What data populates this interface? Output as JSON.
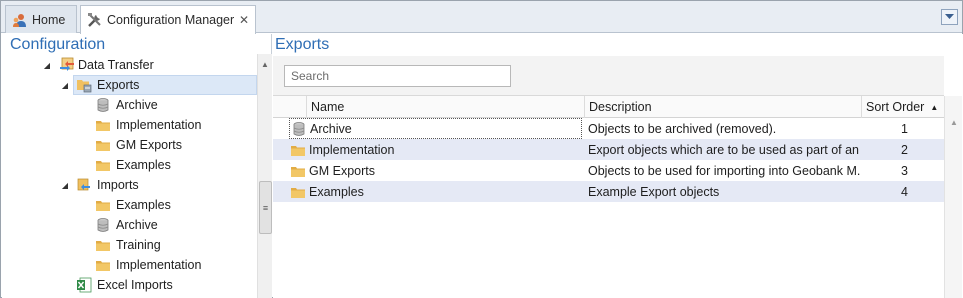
{
  "tabs": [
    {
      "label": "Home",
      "icon": "home-icon"
    },
    {
      "label": "Configuration Manager",
      "icon": "tools-icon"
    }
  ],
  "left_pane": {
    "title": "Configuration",
    "tree": [
      {
        "label": "Data Transfer",
        "icon": "data-transfer-icon",
        "expanded": true,
        "selected": false
      },
      {
        "label": "Exports",
        "icon": "exports-icon",
        "expanded": true,
        "selected": true
      },
      {
        "label": "Archive",
        "icon": "archive-icon",
        "expanded": false,
        "selected": false
      },
      {
        "label": "Implementation",
        "icon": "folder-icon",
        "expanded": false,
        "selected": false
      },
      {
        "label": "GM Exports",
        "icon": "folder-icon",
        "expanded": false,
        "selected": false
      },
      {
        "label": "Examples",
        "icon": "folder-icon",
        "expanded": false,
        "selected": false
      },
      {
        "label": "Imports",
        "icon": "imports-icon",
        "expanded": true,
        "selected": false
      },
      {
        "label": "Examples",
        "icon": "folder-icon",
        "expanded": false,
        "selected": false
      },
      {
        "label": "Archive",
        "icon": "archive-icon",
        "expanded": false,
        "selected": false
      },
      {
        "label": "Training",
        "icon": "folder-icon",
        "expanded": false,
        "selected": false
      },
      {
        "label": "Implementation",
        "icon": "folder-icon",
        "expanded": false,
        "selected": false
      },
      {
        "label": "Excel Imports",
        "icon": "excel-icon",
        "expanded": false,
        "selected": false
      }
    ]
  },
  "right_pane": {
    "title": "Exports",
    "search": {
      "placeholder": "Search",
      "value": ""
    },
    "columns": [
      "Name",
      "Description",
      "Sort Order"
    ],
    "sorted_column": "Sort Order",
    "rows": [
      {
        "name": "Archive",
        "icon": "archive-icon",
        "description": "Objects to be archived (removed).",
        "sort_order": "1"
      },
      {
        "name": "Implementation",
        "icon": "folder-icon",
        "description": "Export objects which are to be used as part of an i...",
        "sort_order": "2"
      },
      {
        "name": "GM Exports",
        "icon": "folder-icon",
        "description": "Objects to be used for importing into Geobank M...",
        "sort_order": "3"
      },
      {
        "name": "Examples",
        "icon": "folder-icon",
        "description": "Example Export objects",
        "sort_order": "4"
      }
    ]
  },
  "colors": {
    "accent_title": "#2f6eb5",
    "selection": "#dce8f7",
    "alt_row": "#e5e9f5",
    "folder": "#e8b547"
  }
}
